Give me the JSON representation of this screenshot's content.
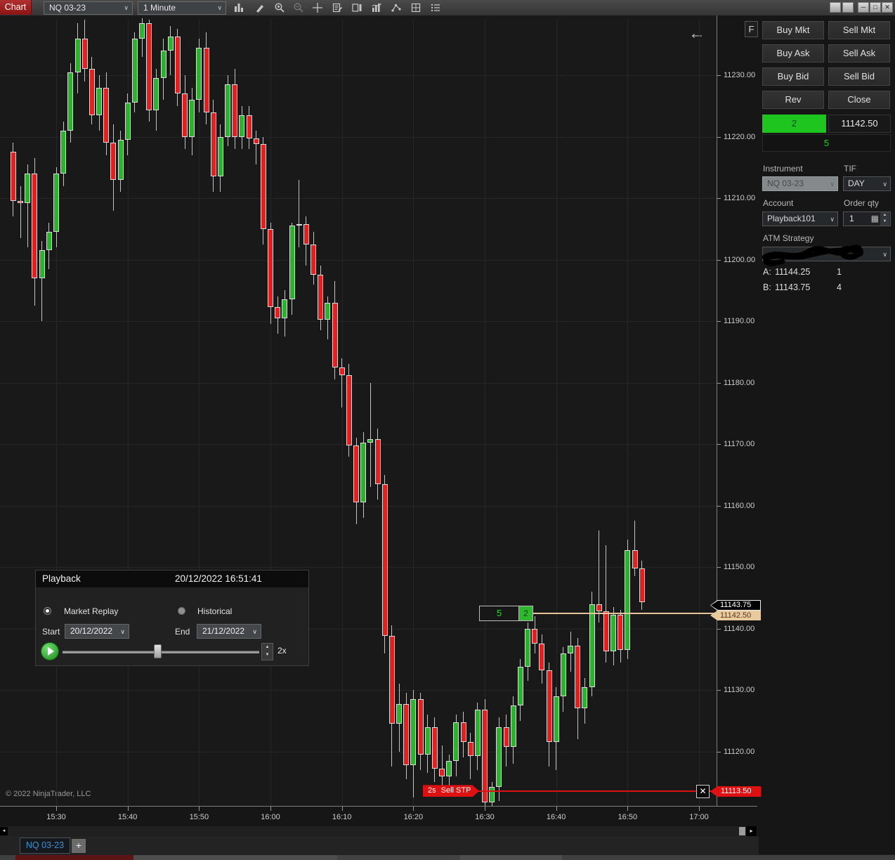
{
  "window": {
    "app_tab": "Chart"
  },
  "toolbar": {
    "instrument": "NQ 03-23",
    "interval": "1 Minute",
    "icons": [
      "bars",
      "pencil",
      "zoom-in",
      "zoom-out",
      "crosshair",
      "notes",
      "chart-trader",
      "indicators",
      "polyline",
      "grid",
      "list"
    ]
  },
  "chart": {
    "back_arrow": "←",
    "focus_button": "F",
    "copyright": "© 2022 NinjaTrader, LLC"
  },
  "chart_data": {
    "type": "candlestick",
    "instrument": "NQ 03-23",
    "interval": "1 Minute",
    "start_time": "15:24",
    "interval_minutes": 1,
    "ylim": [
      11111,
      11239.5
    ],
    "grid": true,
    "x_ticks": [
      {
        "label": "15:30",
        "min": 0
      },
      {
        "label": "15:40",
        "min": 10
      },
      {
        "label": "15:50",
        "min": 20
      },
      {
        "label": "16:00",
        "min": 30
      },
      {
        "label": "16:10",
        "min": 40
      },
      {
        "label": "16:20",
        "min": 50
      },
      {
        "label": "16:30",
        "min": 60
      },
      {
        "label": "16:40",
        "min": 70
      },
      {
        "label": "16:50",
        "min": 80
      },
      {
        "label": "17:00",
        "min": 90
      }
    ],
    "y_ticks": [
      {
        "label": "11230.00",
        "price": 11230
      },
      {
        "label": "11220.00",
        "price": 11220
      },
      {
        "label": "11210.00",
        "price": 11210
      },
      {
        "label": "11200.00",
        "price": 11200
      },
      {
        "label": "11190.00",
        "price": 11190
      },
      {
        "label": "11180.00",
        "price": 11180
      },
      {
        "label": "11170.00",
        "price": 11170
      },
      {
        "label": "11160.00",
        "price": 11160
      },
      {
        "label": "11150.00",
        "price": 11150
      },
      {
        "label": "11140.00",
        "price": 11140
      },
      {
        "label": "11130.00",
        "price": 11130
      },
      {
        "label": "11120.00",
        "price": 11120
      }
    ],
    "colors": {
      "up": "#2db22d",
      "down": "#e41f1f",
      "wick": "#c4c4c4",
      "entry_line": "#e7c49c",
      "stop_line": "#dd1111"
    },
    "candles": [
      [
        11217.5,
        11219,
        11207,
        11209.5
      ],
      [
        11209.5,
        11212,
        11203.5,
        11209.25
      ],
      [
        11209.25,
        11215.5,
        11202,
        11214
      ],
      [
        11214,
        11216.5,
        11192.5,
        11197
      ],
      [
        11197,
        11203,
        11190,
        11201.5
      ],
      [
        11201.5,
        11206,
        11198.5,
        11204.5
      ],
      [
        11204.5,
        11215,
        11202,
        11214
      ],
      [
        11214,
        11222.5,
        11212,
        11221
      ],
      [
        11221,
        11232,
        11219,
        11230.5
      ],
      [
        11230.5,
        11238.5,
        11227,
        11236
      ],
      [
        11236,
        11239,
        11229,
        11231
      ],
      [
        11231,
        11233,
        11222,
        11223.5
      ],
      [
        11223.5,
        11230,
        11221,
        11228
      ],
      [
        11228,
        11230.5,
        11217,
        11219
      ],
      [
        11219,
        11222,
        11208,
        11213
      ],
      [
        11213,
        11221,
        11211,
        11219.5
      ],
      [
        11219.5,
        11227,
        11217,
        11225.5
      ],
      [
        11225.5,
        11237,
        11224,
        11236
      ],
      [
        11236,
        11239.25,
        11233,
        11238.5
      ],
      [
        11238.5,
        11239,
        11222.5,
        11224.25
      ],
      [
        11224.25,
        11231,
        11221,
        11229.5
      ],
      [
        11229.5,
        11236,
        11226,
        11234
      ],
      [
        11234,
        11238,
        11230,
        11236.25
      ],
      [
        11236.25,
        11237.5,
        11225,
        11227
      ],
      [
        11227,
        11230,
        11218,
        11220
      ],
      [
        11220,
        11228,
        11217,
        11226
      ],
      [
        11226,
        11236,
        11224,
        11234.5
      ],
      [
        11234.5,
        11237,
        11222,
        11224
      ],
      [
        11224,
        11226,
        11211,
        11213.5
      ],
      [
        11213.5,
        11222,
        11211,
        11220
      ],
      [
        11220,
        11230,
        11218.5,
        11228.5
      ],
      [
        11228.5,
        11231,
        11218,
        11220
      ],
      [
        11220,
        11225,
        11218,
        11223.5
      ],
      [
        11223.5,
        11225,
        11218,
        11219.75
      ],
      [
        11219.75,
        11221,
        11215.5,
        11218.75
      ],
      [
        11218.75,
        11220,
        11202.5,
        11205
      ],
      [
        11205,
        11206,
        11189.5,
        11192.25
      ],
      [
        11192.25,
        11194,
        11188,
        11190.5
      ],
      [
        11190.5,
        11195,
        11187.5,
        11193.5
      ],
      [
        11193.5,
        11206,
        11191,
        11205.5
      ],
      [
        11205.5,
        11213,
        11202,
        11205.75
      ],
      [
        11205.75,
        11207,
        11199,
        11202.5
      ],
      [
        11202.5,
        11204.5,
        11196,
        11197.5
      ],
      [
        11197.5,
        11199,
        11188.5,
        11190.25
      ],
      [
        11190.25,
        11194,
        11187,
        11193
      ],
      [
        11193,
        11196.5,
        11180.5,
        11182.5
      ],
      [
        11182.5,
        11184,
        11176,
        11181.25
      ],
      [
        11181.25,
        11183,
        11168,
        11169.75
      ],
      [
        11169.75,
        11171,
        11157,
        11160.5
      ],
      [
        11160.5,
        11172,
        11158,
        11170.25
      ],
      [
        11170.25,
        11180,
        11163,
        11170.75
      ],
      [
        11170.75,
        11172.5,
        11161,
        11163.5
      ],
      [
        11163.5,
        11165,
        11136,
        11138.75
      ],
      [
        11138.75,
        11140.5,
        11117.5,
        11124.5
      ],
      [
        11124.5,
        11131,
        11120,
        11127.75
      ],
      [
        11127.75,
        11129.5,
        11115.5,
        11117.75
      ],
      [
        11117.75,
        11130,
        11112.5,
        11128.5
      ],
      [
        11128.5,
        11129.5,
        11117,
        11119.5
      ],
      [
        11119.5,
        11126,
        11116.5,
        11124
      ],
      [
        11124,
        11125.5,
        11115,
        11117.25
      ],
      [
        11117.25,
        11121,
        11114,
        11116
      ],
      [
        11116,
        11119.5,
        11113.75,
        11118.5
      ],
      [
        11118.5,
        11126,
        11116,
        11124.75
      ],
      [
        11124.75,
        11126.5,
        11119,
        11121.5
      ],
      [
        11121.5,
        11123,
        11115.5,
        11119.25
      ],
      [
        11119.25,
        11128,
        11117,
        11126.75
      ],
      [
        11126.75,
        11128.5,
        11110.75,
        11111.75
      ],
      [
        11111.75,
        11115,
        11110.5,
        11114.25
      ],
      [
        11114.25,
        11125.5,
        11112,
        11124
      ],
      [
        11124,
        11126,
        11117.5,
        11120.75
      ],
      [
        11120.75,
        11129,
        11118,
        11127.5
      ],
      [
        11127.5,
        11135,
        11125,
        11133.75
      ],
      [
        11133.75,
        11141,
        11131.5,
        11140
      ],
      [
        11140,
        11142,
        11136,
        11137.5
      ],
      [
        11137.5,
        11139,
        11131,
        11133.25
      ],
      [
        11133.25,
        11134.5,
        11117.5,
        11121.5
      ],
      [
        11121.5,
        11130.5,
        11117,
        11129
      ],
      [
        11129,
        11137,
        11126.5,
        11136
      ],
      [
        11136,
        11139.5,
        11133,
        11137.25
      ],
      [
        11137.25,
        11138.5,
        11122,
        11127
      ],
      [
        11127,
        11132,
        11124.5,
        11130.5
      ],
      [
        11130.5,
        11146,
        11129,
        11144
      ],
      [
        11144,
        11156,
        11141,
        11142.75
      ],
      [
        11142.75,
        11153.5,
        11134.5,
        11136.25
      ],
      [
        11136.25,
        11143.5,
        11134,
        11142.25
      ],
      [
        11142.25,
        11143,
        11134.5,
        11136.5
      ],
      [
        11136.5,
        11154.5,
        11135,
        11152.75
      ],
      [
        11152.75,
        11157.5,
        11148.5,
        11149.75
      ],
      [
        11149.75,
        11151,
        11143,
        11144.25
      ]
    ],
    "markers": {
      "entry": {
        "price": 11142.5,
        "qty_stop": "5",
        "qty_pos": "2",
        "tag": "11142.50"
      },
      "stop": {
        "price": 11113.5,
        "prefix": "2s",
        "text": "Sell STP",
        "tag": "11113.50"
      },
      "last": {
        "price": 11143.75,
        "tag": "11143.75"
      }
    }
  },
  "dom": {
    "buttons": [
      {
        "label": "Buy Mkt",
        "name": "buy-mkt"
      },
      {
        "label": "Sell Mkt",
        "name": "sell-mkt"
      },
      {
        "label": "Buy Ask",
        "name": "buy-ask"
      },
      {
        "label": "Sell Ask",
        "name": "sell-ask"
      },
      {
        "label": "Buy Bid",
        "name": "buy-bid"
      },
      {
        "label": "Sell Bid",
        "name": "sell-bid"
      },
      {
        "label": "Rev",
        "name": "rev"
      },
      {
        "label": "Close",
        "name": "close-position"
      }
    ],
    "position": {
      "qty": "2",
      "price": "11142.50",
      "working": "5"
    },
    "instrument_label": "Instrument",
    "tif_label": "TIF",
    "instrument_value": "NQ 03-23",
    "tif_value": "DAY",
    "account_label": "Account",
    "qty_label": "Order qty",
    "account_value": "Playback101",
    "qty_value": "1",
    "atm_label": "ATM Strategy",
    "quotes": [
      {
        "side": "A:",
        "price": "11144.25",
        "size": "1"
      },
      {
        "side": "B:",
        "price": "11143.75",
        "size": "4"
      }
    ]
  },
  "playback": {
    "title": "Playback",
    "timestamp": "20/12/2022 16:51:41",
    "radio_replay": "Market Replay",
    "radio_historical": "Historical",
    "start_label": "Start",
    "start_value": "20/12/2022",
    "end_label": "End",
    "end_value": "21/12/2022",
    "speed": "2x"
  },
  "bottom": {
    "tab": "NQ 03-23",
    "add_tab": "+",
    "scroll_left": "◂",
    "scroll_right": "▸"
  }
}
